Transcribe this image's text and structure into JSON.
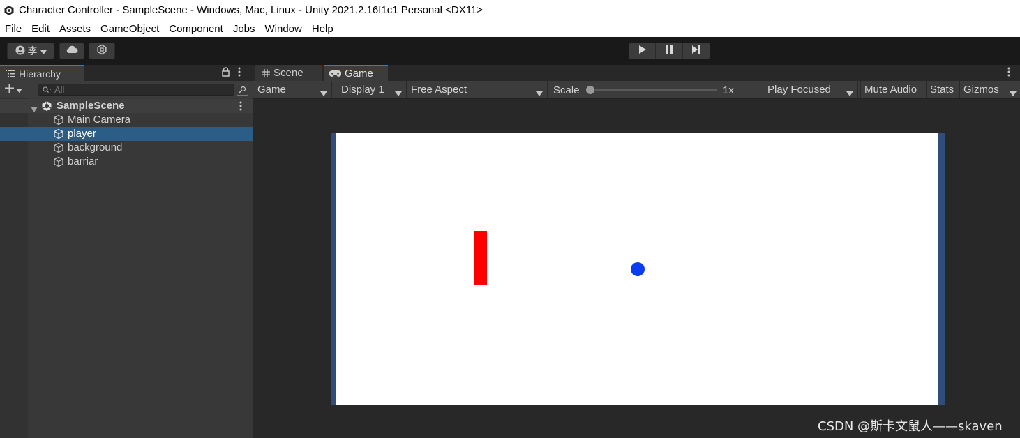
{
  "window": {
    "title": "Character Controller - SampleScene - Windows, Mac, Linux - Unity 2021.2.16f1c1 Personal <DX11>",
    "logo_icon": "unity-logo-icon"
  },
  "menu": [
    "File",
    "Edit",
    "Assets",
    "GameObject",
    "Component",
    "Jobs",
    "Window",
    "Help"
  ],
  "toolbar": {
    "account_label": "李",
    "account_icon": "account-icon",
    "cloud_icon": "cloud-icon",
    "collab_icon": "collab-icon",
    "play_icon": "play-icon",
    "pause_icon": "pause-icon",
    "step_icon": "step-icon"
  },
  "hierarchy": {
    "tab_label": "Hierarchy",
    "search_placeholder": "All",
    "scene": "SampleScene",
    "objects": [
      {
        "name": "Main Camera",
        "selected": false
      },
      {
        "name": "player",
        "selected": true
      },
      {
        "name": "background",
        "selected": false
      },
      {
        "name": "barriar",
        "selected": false
      }
    ]
  },
  "game_panel": {
    "tabs": [
      {
        "label": "Scene",
        "active": false,
        "icon": "grid-icon"
      },
      {
        "label": "Game",
        "active": true,
        "icon": "gamepad-icon"
      }
    ],
    "view_dropdown": "Game",
    "display_dropdown": "Display 1",
    "aspect_dropdown": "Free Aspect",
    "scale_label": "Scale",
    "scale_value": "1x",
    "play_mode_dropdown": "Play Focused",
    "mute_audio": "Mute Audio",
    "stats": "Stats",
    "gizmos": "Gizmos"
  },
  "colors": {
    "player": "#ff0000",
    "ball": "#0b3cf0",
    "selection": "#2c5d87",
    "tab_accent": "#3a79bb",
    "game_border": "#314d79"
  },
  "watermark": "CSDN @斯卡文鼠人——skaven"
}
